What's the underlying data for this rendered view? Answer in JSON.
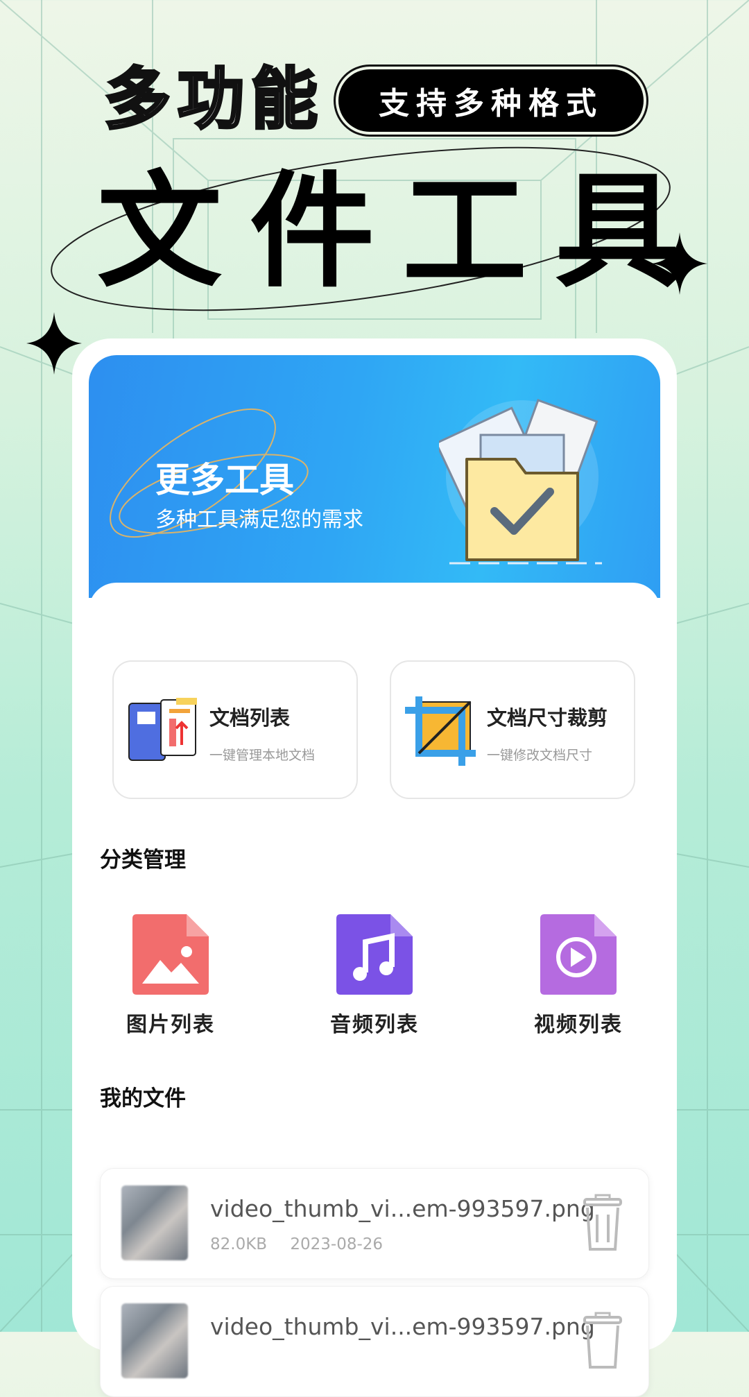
{
  "header": {
    "headline_small": "多功能",
    "pill_label": "支持多种格式",
    "headline_big": "文件工具"
  },
  "banner": {
    "title": "更多工具",
    "subtitle": "多种工具满足您的需求",
    "icon": "folder-check-icon"
  },
  "tools": [
    {
      "title": "文档列表",
      "subtitle": "一键管理本地文档",
      "icon": "document-list-icon"
    },
    {
      "title": "文档尺寸裁剪",
      "subtitle": "一键修改文档尺寸",
      "icon": "crop-icon"
    }
  ],
  "categories": {
    "title": "分类管理",
    "items": [
      {
        "label": "图片列表",
        "icon": "image-file-icon",
        "color": "#f26d6d"
      },
      {
        "label": "音频列表",
        "icon": "audio-file-icon",
        "color": "#7b52e6"
      },
      {
        "label": "视频列表",
        "icon": "video-file-icon",
        "color": "#b56be0"
      }
    ]
  },
  "my_files": {
    "title": "我的文件",
    "files": [
      {
        "name": "video_thumb_vi...em-993597.png",
        "size": "82.0KB",
        "date": "2023-08-26"
      },
      {
        "name": "video_thumb_vi...em-993597.png",
        "size": "",
        "date": ""
      }
    ]
  }
}
